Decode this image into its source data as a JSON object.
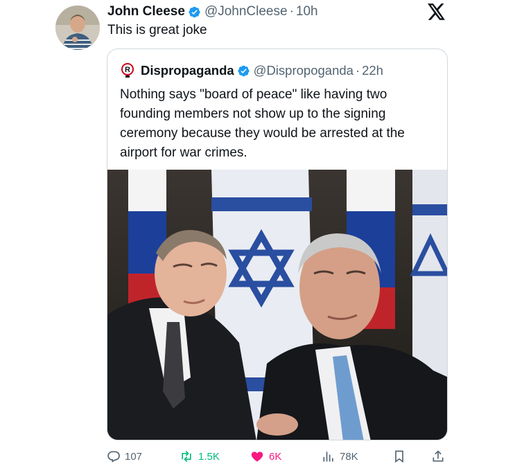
{
  "tweet": {
    "author_name": "John Cleese",
    "handle": "@JohnCleese",
    "separator": "·",
    "time": "10h",
    "text": "This is great joke"
  },
  "quote": {
    "author_name": "Dispropaganda",
    "handle": "@Dispropoganda",
    "separator": "·",
    "time": "22h",
    "text": "Nothing says \"board of peace\" like having two founding members not show up to the signing ceremony because they would be arrested at the airport for war crimes."
  },
  "actions": {
    "replies": "107",
    "reposts": "1.5K",
    "likes": "6K",
    "views": "78K"
  },
  "icons": [
    "verified-badge-icon",
    "x-logo-icon",
    "reply-icon",
    "repost-icon",
    "like-icon",
    "views-icon",
    "bookmark-icon",
    "share-icon"
  ],
  "colors": {
    "verified": "#1d9bf0",
    "repost_active": "#00ba7c",
    "like_active": "#f91880",
    "secondary_text": "#536471",
    "border": "#cfd9de"
  }
}
